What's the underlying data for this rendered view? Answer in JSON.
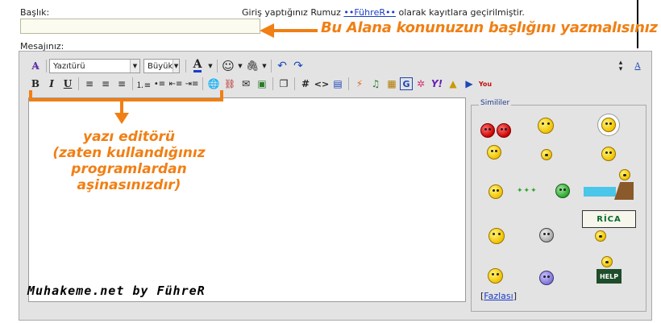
{
  "form": {
    "subject_label": "Başlık:",
    "message_label": "Mesajınız:",
    "login_prefix": "Giriş yaptığınız Rumuz",
    "login_user": "••FührеR••",
    "login_suffix": "olarak kayıtlara geçirilmiştir.",
    "subject_value": ""
  },
  "annotations": {
    "title_hint": "Bu Alana konunuzun başlığını yazmalısınız",
    "editor_hint_lines": [
      "yazı editörü",
      "(zaten kullandığınız",
      "programlardan",
      "aşinasınızdır)"
    ]
  },
  "toolbar": {
    "font_select": "Yazıtürü",
    "size_select": "Büyük",
    "bold": "B",
    "italic": "I",
    "underline": "U",
    "hash": "#",
    "code": "<>",
    "font_color_glyph": "A",
    "toggle_mode_glyph": "A"
  },
  "editor": {
    "content": "",
    "signature": "Muhakeme.net by FührеR"
  },
  "smilies": {
    "legend": "Simililer",
    "more_bracket_open": "[",
    "more_label": "Fazlası",
    "more_bracket_close": "]",
    "rica_text": "RİCA",
    "help_text": "HELP"
  },
  "colors": {
    "accent": "#f07f14",
    "link": "#1a3cc8",
    "panel": "#e3e3e3"
  }
}
